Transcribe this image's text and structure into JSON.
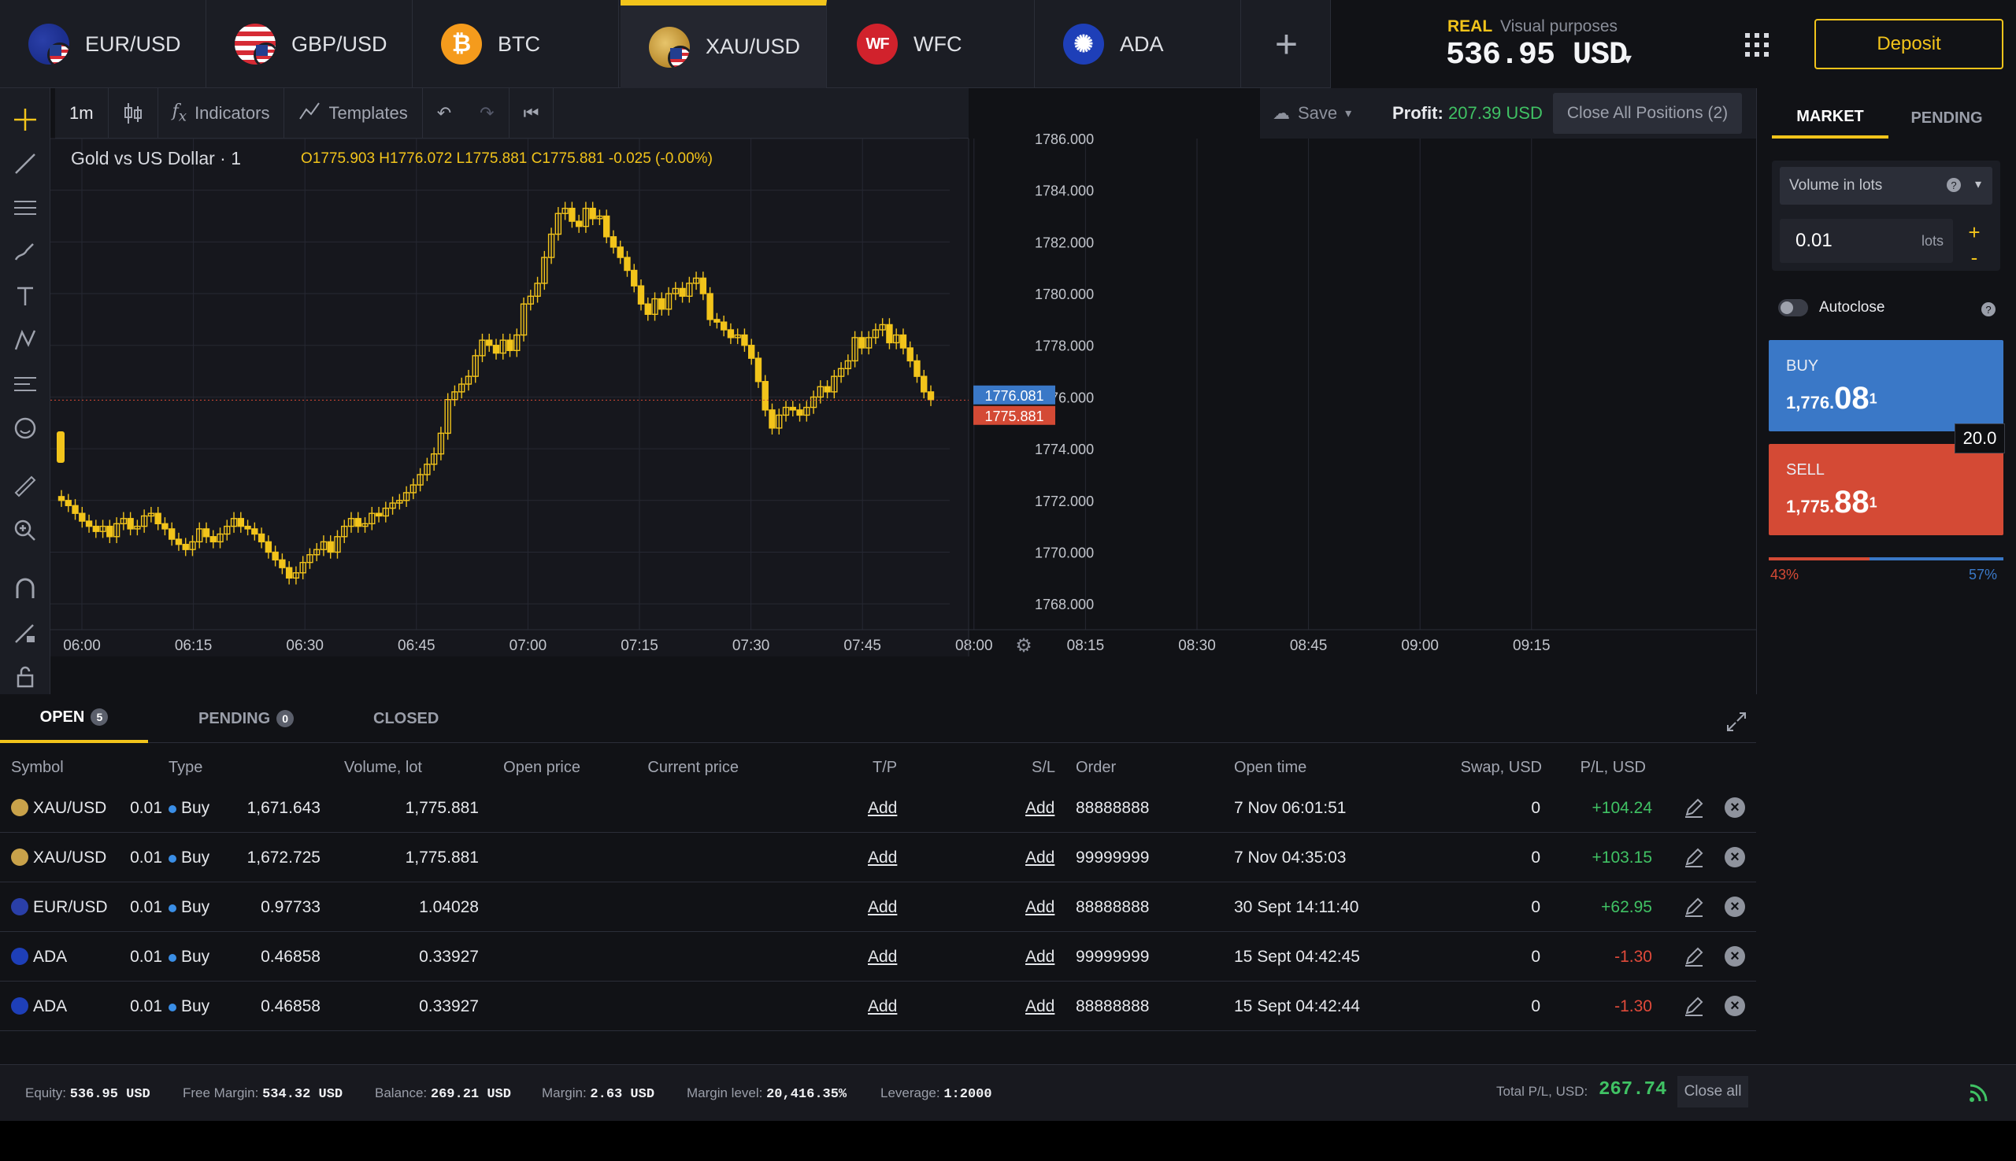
{
  "tabs": [
    {
      "label": "EUR/USD",
      "icon": "eur-usd-flag-icon"
    },
    {
      "label": "GBP/USD",
      "icon": "gbp-usd-flag-icon"
    },
    {
      "label": "BTC",
      "icon": "bitcoin-icon",
      "glyph": "₿"
    },
    {
      "label": "XAU/USD",
      "icon": "gold-usd-icon",
      "active": true
    },
    {
      "label": "WFC",
      "icon": "wells-fargo-icon",
      "glyph": "WF"
    },
    {
      "label": "ADA",
      "icon": "cardano-icon",
      "glyph": "✺"
    }
  ],
  "add_tab": "+",
  "account": {
    "mode": "REAL",
    "note": "Visual purposes",
    "balance": "536.95 USD",
    "caret": "▾"
  },
  "deposit_label": "Deposit",
  "toolbar": {
    "timeframe": "1m",
    "indicators": "Indicators",
    "templates": "Templates",
    "save": "Save",
    "profit_label": "Profit:",
    "profit_value": "207.39 USD",
    "close_all_positions": "Close All Positions (2)"
  },
  "chart": {
    "title": "Gold vs US Dollar · 1",
    "ohlc": "O1775.903  H1776.072  L1775.881  C1775.881  -0.025 (-0.00%)",
    "ask_tag": "1776.081",
    "bid_tag": "1775.881"
  },
  "chart_data": {
    "type": "candlestick",
    "title": "Gold vs US Dollar · 1",
    "x_ticks": [
      "06:00",
      "06:15",
      "06:30",
      "06:45",
      "07:00",
      "07:15",
      "07:30",
      "07:45",
      "08:00",
      "08:15",
      "08:30",
      "08:45",
      "09:00",
      "09:15"
    ],
    "y_ticks": [
      "1768.000",
      "1770.000",
      "1772.000",
      "1774.000",
      "1776.000",
      "1778.000",
      "1780.000",
      "1782.000",
      "1784.000",
      "1786.000"
    ],
    "ylim": [
      1767.0,
      1786.0
    ],
    "close_series": [
      1772.0,
      1771.8,
      1771.5,
      1771.2,
      1771.0,
      1770.8,
      1771.0,
      1770.6,
      1771.1,
      1771.3,
      1770.9,
      1771.0,
      1771.4,
      1771.5,
      1771.1,
      1770.9,
      1770.5,
      1770.3,
      1770.1,
      1770.4,
      1770.9,
      1770.6,
      1770.4,
      1770.7,
      1771.0,
      1771.3,
      1771.0,
      1770.9,
      1770.7,
      1770.4,
      1770.0,
      1769.7,
      1769.4,
      1769.0,
      1769.2,
      1769.6,
      1769.9,
      1770.1,
      1770.4,
      1770.0,
      1770.6,
      1771.0,
      1771.3,
      1771.0,
      1771.1,
      1771.5,
      1771.4,
      1771.7,
      1771.9,
      1772.0,
      1772.3,
      1772.6,
      1773.0,
      1773.4,
      1773.8,
      1774.6,
      1775.9,
      1776.2,
      1776.5,
      1776.8,
      1777.6,
      1778.2,
      1778.0,
      1777.7,
      1778.2,
      1777.8,
      1778.4,
      1779.6,
      1779.9,
      1780.4,
      1781.4,
      1782.3,
      1783.1,
      1783.3,
      1782.8,
      1782.6,
      1783.3,
      1782.9,
      1783.0,
      1782.2,
      1781.8,
      1781.4,
      1780.9,
      1780.3,
      1779.6,
      1779.2,
      1779.8,
      1779.4,
      1780.0,
      1780.2,
      1779.9,
      1780.4,
      1780.6,
      1780.0,
      1779.0,
      1778.9,
      1778.6,
      1778.3,
      1778.4,
      1778.0,
      1777.5,
      1776.6,
      1775.5,
      1774.8,
      1775.3,
      1775.6,
      1775.5,
      1775.3,
      1775.6,
      1776.0,
      1776.4,
      1776.2,
      1776.8,
      1777.1,
      1777.4,
      1778.3,
      1777.9,
      1778.3,
      1778.6,
      1778.8,
      1778.1,
      1778.4,
      1777.9,
      1777.4,
      1776.8,
      1776.2,
      1775.9
    ],
    "series_color": "#f2c41b",
    "grid": true
  },
  "right_panel": {
    "tab_market": "MARKET",
    "tab_pending": "PENDING",
    "volume_type": "Volume in lots",
    "volume_value": "0.01",
    "volume_unit": "lots",
    "plus": "+",
    "minus": "-",
    "autoclose": "Autoclose",
    "buy_label": "BUY",
    "buy_small": "1,776.",
    "buy_big": "08",
    "buy_sup": "1",
    "sell_label": "SELL",
    "sell_small": "1,775.",
    "sell_big": "88",
    "sell_sup": "1",
    "spread": "20.0",
    "sell_pct": "43%",
    "buy_pct": "57%",
    "sell_pct_value": 43
  },
  "bottom_tabs": {
    "open": "OPEN",
    "open_count": "5",
    "pending": "PENDING",
    "pending_count": "0",
    "closed": "CLOSED"
  },
  "columns": [
    "Symbol",
    "Type",
    "Volume, lot",
    "Open price",
    "Current price",
    "T/P",
    "S/L",
    "Order",
    "Open time",
    "Swap, USD",
    "P/L, USD"
  ],
  "positions": [
    {
      "symbol": "XAU/USD",
      "type": "Buy",
      "volume": "0.01",
      "open": "1,671.643",
      "current": "1,775.881",
      "tp": "Add",
      "sl": "Add",
      "order": "88888888",
      "time": "7 Nov 06:01:51",
      "swap": "0",
      "pl": "+104.24",
      "neg": false
    },
    {
      "symbol": "XAU/USD",
      "type": "Buy",
      "volume": "0.01",
      "open": "1,672.725",
      "current": "1,775.881",
      "tp": "Add",
      "sl": "Add",
      "order": "99999999",
      "time": "7 Nov 04:35:03",
      "swap": "0",
      "pl": "+103.15",
      "neg": false
    },
    {
      "symbol": "EUR/USD",
      "type": "Buy",
      "volume": "0.01",
      "open": "0.97733",
      "current": "1.04028",
      "tp": "Add",
      "sl": "Add",
      "order": "88888888",
      "time": "30 Sept 14:11:40",
      "swap": "0",
      "pl": "+62.95",
      "neg": false
    },
    {
      "symbol": "ADA",
      "type": "Buy",
      "volume": "0.01",
      "open": "0.46858",
      "current": "0.33927",
      "tp": "Add",
      "sl": "Add",
      "order": "99999999",
      "time": "15 Sept 04:42:45",
      "swap": "0",
      "pl": "-1.30",
      "neg": true
    },
    {
      "symbol": "ADA",
      "type": "Buy",
      "volume": "0.01",
      "open": "0.46858",
      "current": "0.33927",
      "tp": "Add",
      "sl": "Add",
      "order": "88888888",
      "time": "15 Sept 04:42:44",
      "swap": "0",
      "pl": "-1.30",
      "neg": true
    }
  ],
  "footer": {
    "equity_label": "Equity:",
    "equity": "536.95 USD",
    "free_margin_label": "Free Margin:",
    "free_margin": "534.32 USD",
    "balance_label": "Balance:",
    "balance": "269.21 USD",
    "margin_label": "Margin:",
    "margin": "2.63 USD",
    "margin_level_label": "Margin level:",
    "margin_level": "20,416.35%",
    "leverage_label": "Leverage:",
    "leverage": "1:2000",
    "total_label": "Total P/L, USD:",
    "total": "267.74",
    "close_all": "Close all"
  }
}
